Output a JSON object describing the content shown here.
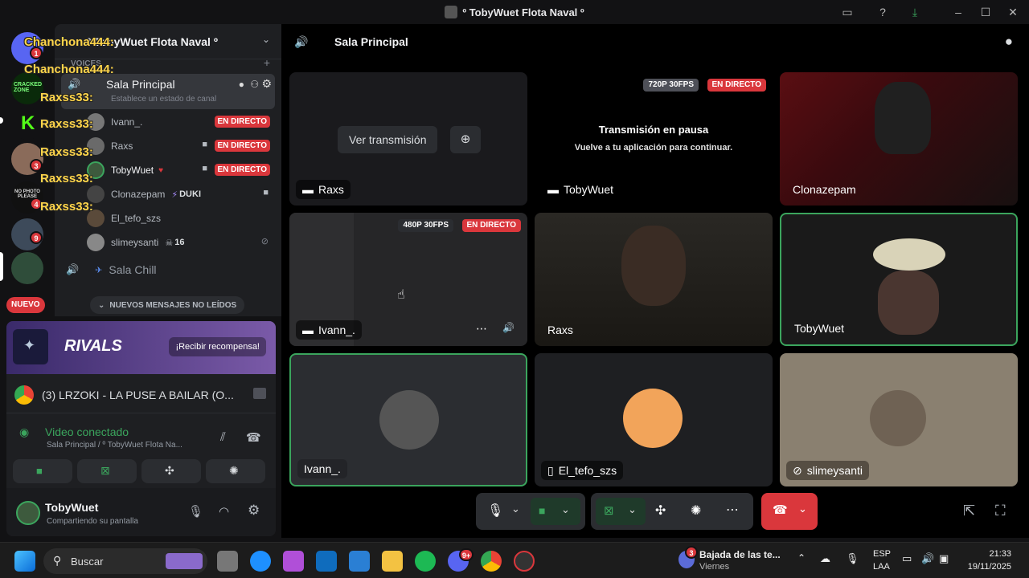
{
  "window": {
    "title": "º TobyWuet Flota Naval º"
  },
  "rail": {
    "badges": [
      "1",
      "3",
      "4",
      "9"
    ],
    "new_label": "NUEVO",
    "server_labels": [
      "CRACKED ZONE",
      "NO PHOTO PLEASE"
    ]
  },
  "overlay": {
    "lines": [
      "Chanchona444:",
      "Chanchona444:",
      "Raxss33:",
      "Raxss33:",
      "Raxss33:",
      "Raxss33:",
      "Raxss33:"
    ]
  },
  "sidebar": {
    "server_name": "º TobyWuet Flota Naval º",
    "category": "VOICES",
    "channel": "Sala Principal",
    "status_placeholder": "Establece un estado de canal",
    "members": [
      {
        "name": "Ivann_.",
        "live": "EN DIRECTO"
      },
      {
        "name": "Raxs",
        "live": "EN DIRECTO"
      },
      {
        "name": "TobyWuet",
        "live": "EN DIRECTO"
      },
      {
        "name": "Clonazepam",
        "activity": "DUKI"
      },
      {
        "name": "El_tefo_szs"
      },
      {
        "name": "slimeysanti",
        "count": "16"
      }
    ],
    "channel2": "Sala Chill",
    "unread": "NUEVOS MENSAJES NO LEÍDOS"
  },
  "promo": {
    "brand": "RIVALS",
    "button": "¡Recibir recompensa!"
  },
  "activity": {
    "title": "(3) LRZOKI - LA PUSE A BAILAR (O..."
  },
  "voice": {
    "status": "Video conectado",
    "location": "Sala Principal / º TobyWuet Flota Na..."
  },
  "user": {
    "name": "TobyWuet",
    "status": "Compartiendo su pantalla"
  },
  "stage": {
    "header_channel": "Sala Principal",
    "tiles": [
      {
        "name": "Raxs",
        "button": "Ver transmisión"
      },
      {
        "name": "TobyWuet",
        "quality": "720P 30FPS",
        "live": "EN DIRECTO",
        "paused_title": "Transmisión en pausa",
        "paused_sub": "Vuelve a tu aplicación para continuar."
      },
      {
        "name": "Clonazepam"
      },
      {
        "name": "Ivann_.",
        "quality": "480P 30FPS",
        "live": "EN DIRECTO"
      },
      {
        "name": "Raxs"
      },
      {
        "name": "TobyWuet"
      },
      {
        "name": "Ivann_."
      },
      {
        "name": "El_tefo_szs"
      },
      {
        "name": "slimeysanti"
      }
    ]
  },
  "taskbar": {
    "search": "Buscar",
    "news_title": "Bajada de las te...",
    "news_sub": "Viernes",
    "news_badge": "3",
    "discord_badge": "9+",
    "lang": "ESP",
    "lang2": "LAA",
    "time": "21:33",
    "date": "19/11/2025"
  }
}
